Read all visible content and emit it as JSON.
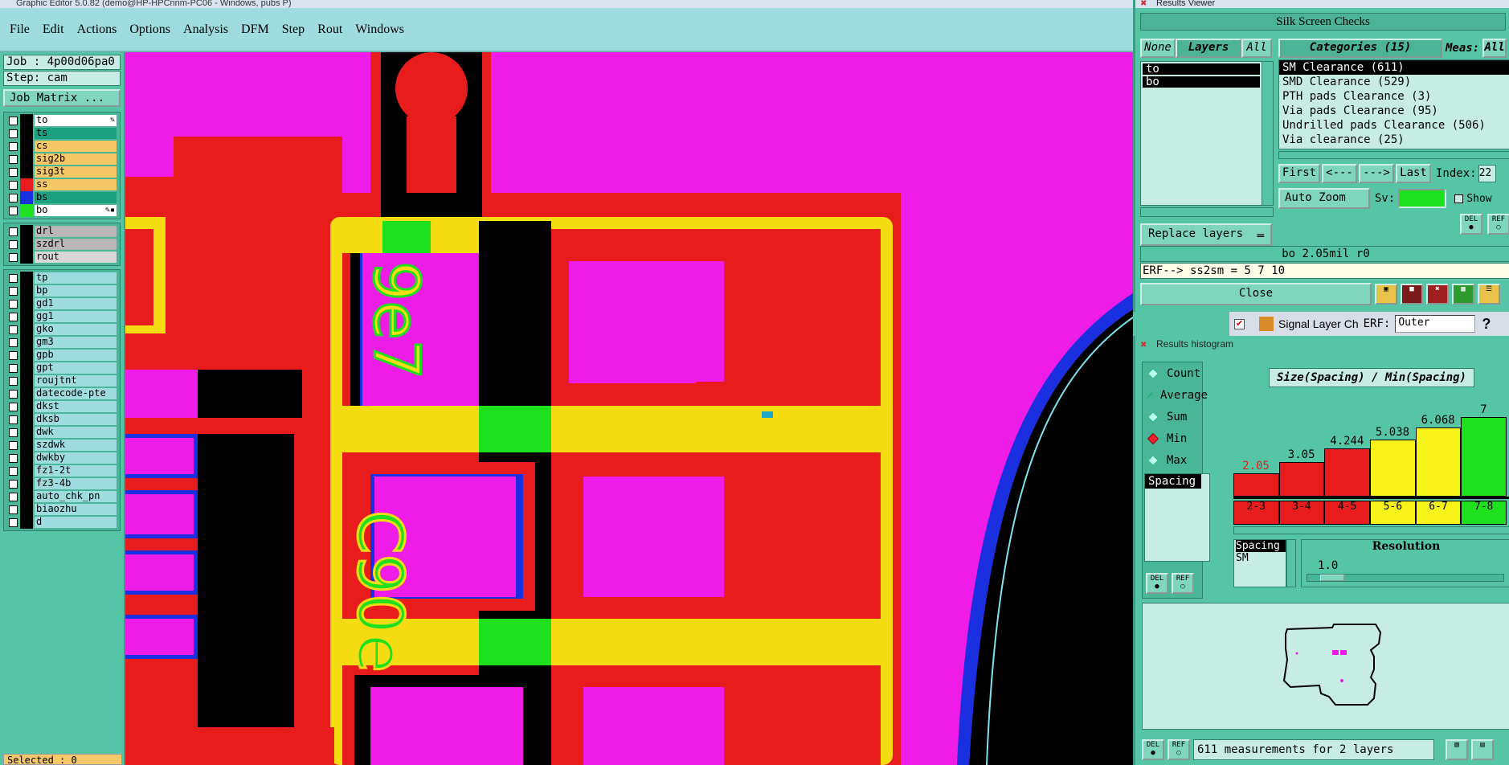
{
  "main_window": {
    "title": "Graphic Editor 5.0.82 (demo@HP-HPCnnm-PC06 - Windows, pubs P)",
    "menus": [
      "File",
      "Edit",
      "Actions",
      "Options",
      "Analysis",
      "DFM",
      "Step",
      "Rout",
      "Windows"
    ],
    "job_label": "Job : 4p00d06pa0",
    "step_label": "Step: cam",
    "job_matrix_button": "Job Matrix ...",
    "selected_status": "Selected : 0",
    "layers_group1": [
      {
        "name": "to",
        "color": "#ffffff",
        "swatch": "#000000",
        "flag": "✎"
      },
      {
        "name": "ts",
        "color": "#1a9f7f",
        "swatch": "#000000",
        "flag": ""
      },
      {
        "name": "cs",
        "color": "#f5c765",
        "swatch": "#000000",
        "flag": ""
      },
      {
        "name": "sig2b",
        "color": "#f5c765",
        "swatch": "#000000",
        "flag": ""
      },
      {
        "name": "sig3t",
        "color": "#f5c765",
        "swatch": "#000000",
        "flag": ""
      },
      {
        "name": "ss",
        "color": "#f5c765",
        "swatch": "#e81c1c",
        "flag": ""
      },
      {
        "name": "bs",
        "color": "#1a9f7f",
        "swatch": "#1a2fe0",
        "flag": ""
      },
      {
        "name": "bo",
        "color": "#ffffff",
        "swatch": "#1ee01e",
        "flag": "✎▪"
      }
    ],
    "layers_group2": [
      {
        "name": "drl",
        "color": "#b8b8b8"
      },
      {
        "name": "szdrl",
        "color": "#b8b8b8"
      },
      {
        "name": "rout",
        "color": "#d8d8d8"
      }
    ],
    "layers_group3": [
      "tp",
      "bp",
      "gd1",
      "gg1",
      "gko",
      "gm3",
      "gpb",
      "gpt",
      "roujtnt",
      "datecode-pte",
      "dkst",
      "dksb",
      "dwk",
      "szdwk",
      "dwkby",
      "fz1-2t",
      "fz3-4b",
      "auto_chk_pn",
      "biaozhu",
      "d"
    ]
  },
  "results_viewer": {
    "title": "Results Viewer",
    "header": "Silk Screen Checks",
    "none_btn": "None",
    "layers_btn": "Layers",
    "all_btn": "All",
    "categories_btn": "Categories (15)",
    "meas_label": "Meas:",
    "meas_value": "All",
    "layers": [
      "to",
      "bo"
    ],
    "categories": [
      "SM Clearance (611)",
      "SMD Clearance (529)",
      "PTH pads Clearance (3)",
      "Via pads Clearance (95)",
      "Undrilled pads Clearance (506)",
      "Via clearance (25)"
    ],
    "nav": {
      "first": "First",
      "prev": "<---",
      "next": "--->",
      "last": "Last",
      "index_label": "Index:",
      "index_value": "22"
    },
    "auto_zoom": "Auto Zoom",
    "sv_label": "Sv:",
    "show_label": "Show",
    "replace_layers": "Replace layers",
    "info": "bo 2.05mil  r0",
    "erf": "ERF--> ss2sm = 5 7 10",
    "close": "Close",
    "strip": {
      "label": "Signal Layer Ch",
      "erf": "ERF:",
      "erf_value": "Outer",
      "help": "?"
    }
  },
  "histogram": {
    "title": "Results histogram",
    "options": [
      {
        "label": "Count",
        "on": false
      },
      {
        "label": "Average",
        "on": false
      },
      {
        "label": "Sum",
        "on": false
      },
      {
        "label": "Min",
        "on": true
      },
      {
        "label": "Max",
        "on": false
      }
    ],
    "attr_list": [
      "Spacing"
    ],
    "header": "Size(Spacing) / Min(Spacing)",
    "spacing_label": "Spacing",
    "sm_label": "SM",
    "resolution_label": "Resolution",
    "resolution_value": "1.0",
    "summary": "611 measurements for 2 layers"
  },
  "chart_data": {
    "type": "bar",
    "title": "Size(Spacing) / Min(Spacing)",
    "categories": [
      "2-3",
      "3-4",
      "4-5",
      "5-6",
      "6-7",
      "7-8"
    ],
    "values": [
      2.05,
      3.05,
      4.244,
      5.038,
      6.068,
      7
    ],
    "labels": [
      "2.05",
      "3.05",
      "4.244",
      "5.038",
      "6.068",
      "7"
    ],
    "colors": [
      "#e81c1c",
      "#e81c1c",
      "#e81c1c",
      "#f6f21a",
      "#f6f21a",
      "#1ee01e"
    ],
    "ylim": [
      0,
      7.5
    ]
  }
}
